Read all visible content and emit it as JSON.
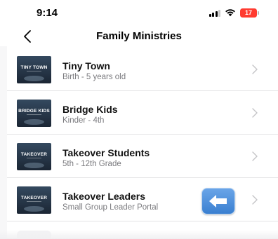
{
  "status_bar": {
    "time": "9:14",
    "battery_level": "17",
    "battery_color": "#ff3b30",
    "signal_icon": "cellular-signal-icon",
    "wifi_icon": "wifi-icon"
  },
  "nav": {
    "title": "Family Ministries",
    "back_icon": "chevron-left-icon"
  },
  "list": {
    "items": [
      {
        "title": "Tiny Town",
        "subtitle": "Birth - 5 years old",
        "thumb_text": "TINY TOWN"
      },
      {
        "title": "Bridge Kids",
        "subtitle": "Kinder - 4th",
        "thumb_text": "BRIDGE KIDS"
      },
      {
        "title": "Takeover Students",
        "subtitle": "5th - 12th Grade",
        "thumb_text": "TAKEOVER"
      },
      {
        "title": "Takeover Leaders",
        "subtitle": "Small Group Leader Portal",
        "thumb_text": "TAKEOVER"
      }
    ],
    "row_chevron_icon": "chevron-right-icon"
  },
  "overlay": {
    "icon": "left-arrow-icon",
    "color": "#3a7fd0"
  }
}
